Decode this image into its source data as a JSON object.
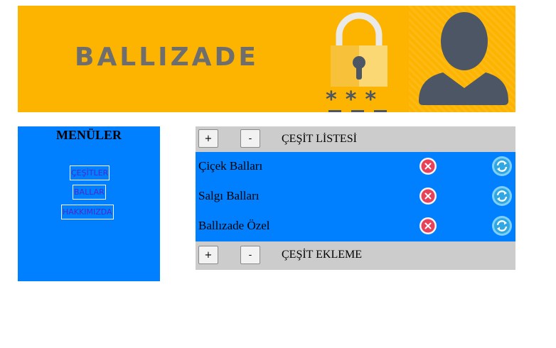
{
  "banner": {
    "brand": "BALLIZADE",
    "lock_icon": "padlock-icon",
    "password_mask": "***",
    "user_icon": "user-avatar-icon",
    "background_color": "#FDB400"
  },
  "sidebar": {
    "title": "MENÜLER",
    "items": [
      {
        "label": "ÇEŞİTLER"
      },
      {
        "label": "BALLAR"
      },
      {
        "label": "HAKKIMIZDA"
      }
    ],
    "background_color": "#0080FF"
  },
  "main": {
    "header": {
      "add_label": "+",
      "remove_label": "-",
      "title": "ÇEŞİT LİSTESİ"
    },
    "rows": [
      {
        "name": "Çiçek Balları",
        "delete_icon": "delete-icon",
        "refresh_icon": "refresh-icon"
      },
      {
        "name": "Salgı Balları",
        "delete_icon": "delete-icon",
        "refresh_icon": "refresh-icon"
      },
      {
        "name": "Ballızade Özel",
        "delete_icon": "delete-icon",
        "refresh_icon": "refresh-icon"
      }
    ],
    "footer": {
      "add_label": "+",
      "remove_label": "-",
      "title": "ÇEŞİT EKLEME"
    },
    "list_background_color": "#0080FF",
    "bar_background_color": "#CCCCCC"
  }
}
